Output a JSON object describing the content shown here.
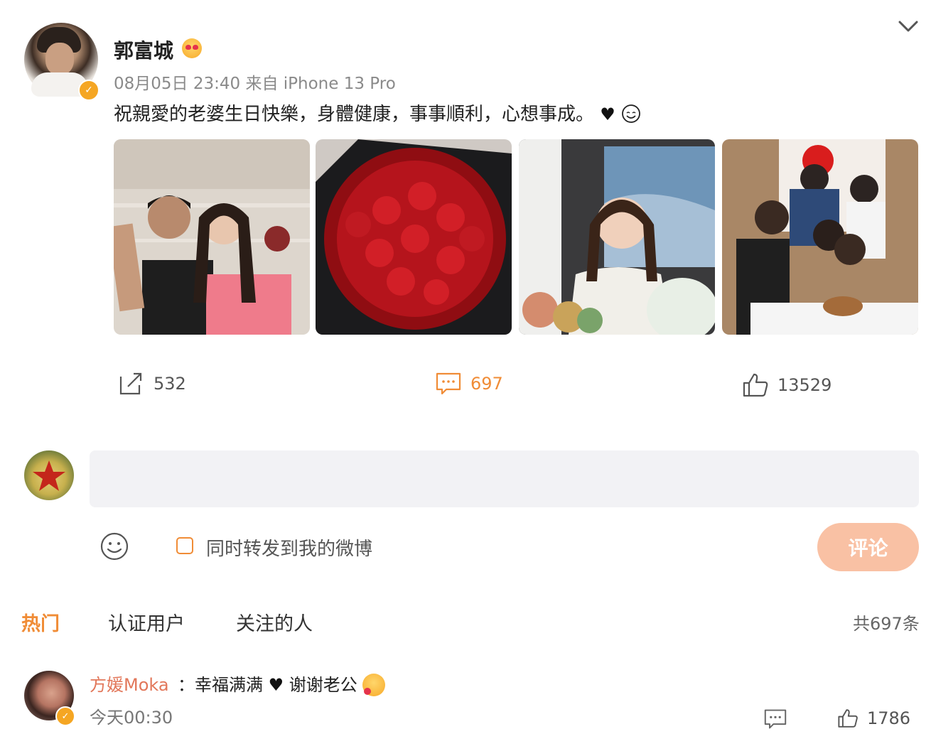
{
  "post": {
    "username": "郭富城",
    "meta": "08月05日 23:40  来自 iPhone 13 Pro",
    "text": "祝親愛的老婆生日快樂，身體健康，事事順利，心想事成。"
  },
  "icons": {
    "verified": "verified-badge-icon",
    "expand": "chevron-down-icon",
    "repost": "repost-icon",
    "comment": "comment-icon",
    "like": "like-icon",
    "emoji": "smiley-icon",
    "heart": "black-heart-icon"
  },
  "actions": {
    "repost_count": "532",
    "comment_count": "697",
    "like_count": "13529"
  },
  "composer": {
    "repost_label": "同时转发到我的微博",
    "submit_label": "评论"
  },
  "tabs": [
    "热门",
    "认证用户",
    "关注的人"
  ],
  "comments_total": "共697条",
  "comment": {
    "name": "方媛Moka",
    "text": "：幸福满满",
    "text2": " 谢谢老公",
    "time": "今天00:30",
    "like_count": "1786"
  },
  "colors": {
    "accent": "#f08c36",
    "verified": "#f5a623",
    "submit_disabled": "#f9c1a4",
    "comment_name": "#e2775a"
  }
}
